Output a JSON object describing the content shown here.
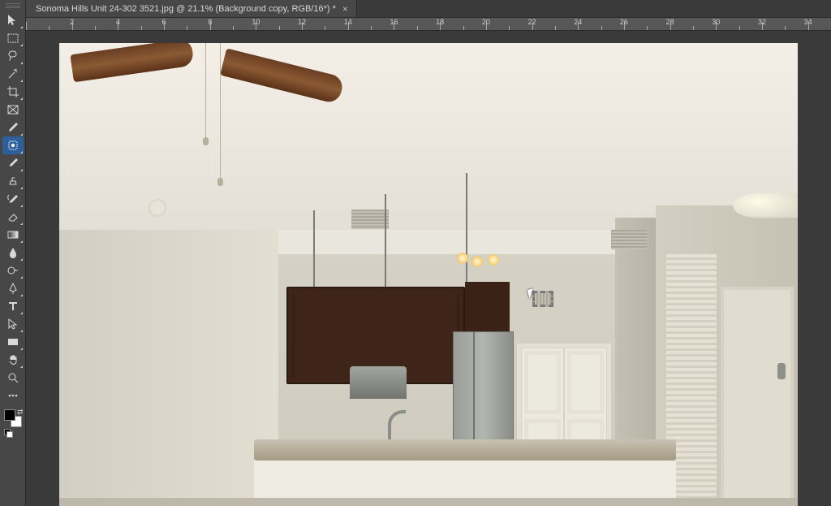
{
  "tab": {
    "label": "Sonoma Hills Unit 24-302 3521.jpg @ 21.1% (Background copy, RGB/16*) *"
  },
  "ruler": {
    "labels": [
      "2",
      "4",
      "6",
      "8",
      "10",
      "12",
      "14",
      "16",
      "18",
      "20",
      "22",
      "24",
      "26",
      "28",
      "30",
      "32",
      "34"
    ]
  },
  "tools": [
    {
      "name": "move-tool",
      "fly": true,
      "selected": false
    },
    {
      "name": "rectangular-marquee-tool",
      "fly": true,
      "selected": false
    },
    {
      "name": "lasso-tool",
      "fly": true,
      "selected": false
    },
    {
      "name": "magic-wand-tool",
      "fly": true,
      "selected": false
    },
    {
      "name": "crop-tool",
      "fly": true,
      "selected": false
    },
    {
      "name": "frame-tool",
      "fly": false,
      "selected": false
    },
    {
      "name": "eyedropper-tool",
      "fly": true,
      "selected": false
    },
    {
      "name": "spot-healing-brush-tool",
      "fly": true,
      "selected": true
    },
    {
      "name": "brush-tool",
      "fly": true,
      "selected": false
    },
    {
      "name": "clone-stamp-tool",
      "fly": true,
      "selected": false
    },
    {
      "name": "history-brush-tool",
      "fly": true,
      "selected": false
    },
    {
      "name": "eraser-tool",
      "fly": true,
      "selected": false
    },
    {
      "name": "gradient-tool",
      "fly": true,
      "selected": false
    },
    {
      "name": "blur-tool",
      "fly": true,
      "selected": false
    },
    {
      "name": "dodge-tool",
      "fly": true,
      "selected": false
    },
    {
      "name": "pen-tool",
      "fly": true,
      "selected": false
    },
    {
      "name": "horizontal-type-tool",
      "fly": true,
      "selected": false
    },
    {
      "name": "path-selection-tool",
      "fly": true,
      "selected": false
    },
    {
      "name": "rectangle-tool",
      "fly": true,
      "selected": false
    },
    {
      "name": "hand-tool",
      "fly": true,
      "selected": false
    },
    {
      "name": "zoom-tool",
      "fly": false,
      "selected": false
    },
    {
      "name": "edit-toolbar",
      "fly": false,
      "selected": false
    }
  ],
  "swatch": {
    "fg": "#000000",
    "bg": "#ffffff"
  }
}
